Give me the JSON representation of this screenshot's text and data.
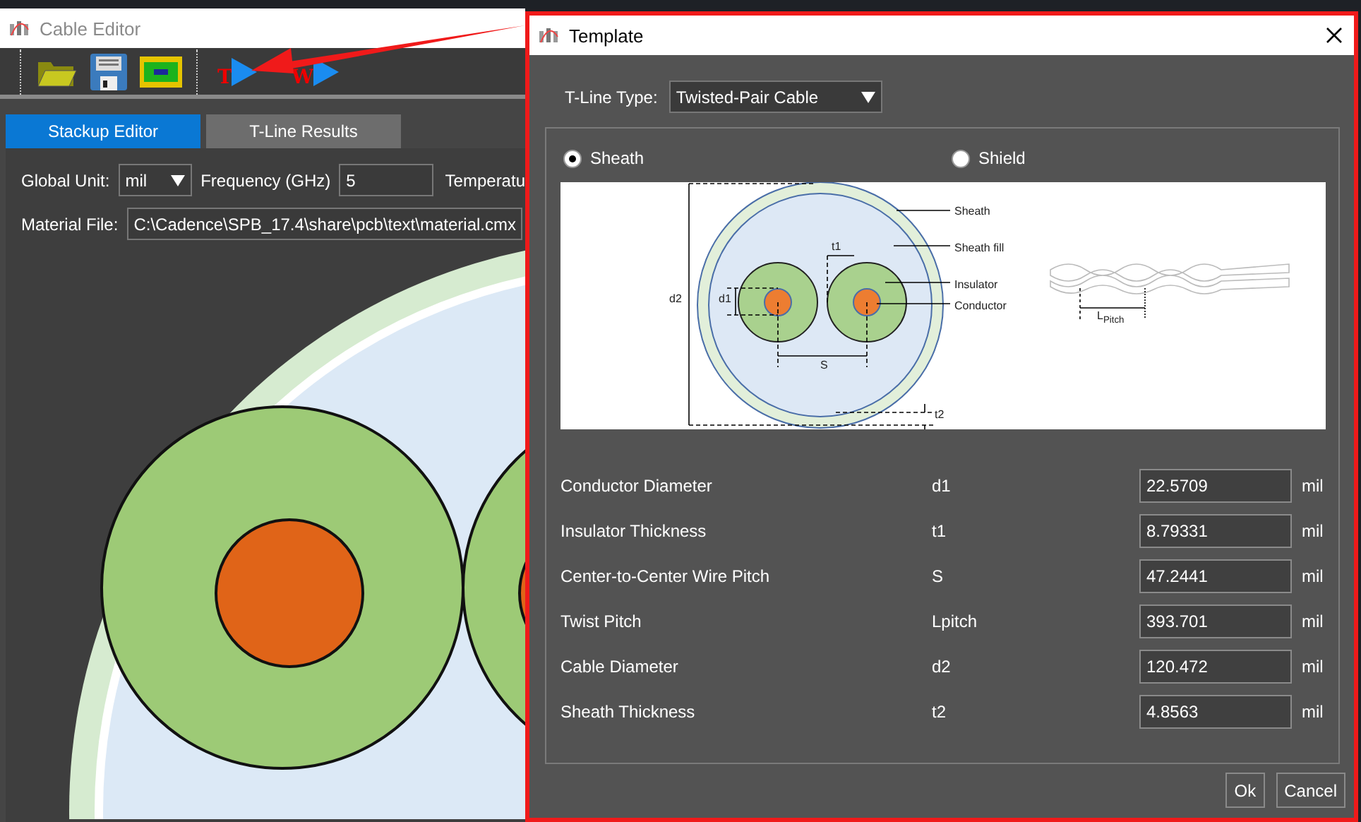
{
  "main_window": {
    "title": "Cable Editor",
    "toolbar": [
      {
        "kind": "open"
      },
      {
        "kind": "save"
      },
      {
        "kind": "layer"
      },
      {
        "kind": "tline",
        "letter": "T"
      },
      {
        "kind": "wline",
        "letter": "W"
      }
    ],
    "tabs": [
      {
        "label": "Stackup Editor",
        "selected": true
      },
      {
        "label": "T-Line Results",
        "selected": false
      }
    ],
    "global_unit": {
      "label": "Global Unit:",
      "value": "mil"
    },
    "frequency": {
      "label": "Frequency (GHz)",
      "value": "5"
    },
    "temperature": {
      "label": "Temperatu"
    },
    "material_file": {
      "label": "Material File:",
      "value": "C:\\Cadence\\SPB_17.4\\share\\pcb\\text\\material.cmx"
    }
  },
  "dialog": {
    "title": "Template",
    "tline_type": {
      "label": "T-Line Type:",
      "value": "Twisted-Pair Cable"
    },
    "options": [
      {
        "label": "Sheath",
        "selected": true
      },
      {
        "label": "Shield",
        "selected": false
      }
    ],
    "diagram_labels": [
      "Sheath",
      "Sheath fill",
      "Insulator",
      "Conductor",
      "d2",
      "d1",
      "t1",
      "S",
      "t2",
      "L$_{Pitch}$"
    ],
    "parameters": [
      {
        "name": "Conductor Diameter",
        "symbol": "d1",
        "value": "22.5709",
        "unit": "mil"
      },
      {
        "name": "Insulator Thickness",
        "symbol": "t1",
        "value": "8.79331",
        "unit": "mil"
      },
      {
        "name": "Center-to-Center Wire Pitch",
        "symbol": "S",
        "value": "47.2441",
        "unit": "mil"
      },
      {
        "name": "Twist Pitch",
        "symbol": "Lpitch",
        "value": "393.701",
        "unit": "mil"
      },
      {
        "name": "Cable Diameter",
        "symbol": "d2",
        "value": "120.472",
        "unit": "mil"
      },
      {
        "name": "Sheath Thickness",
        "symbol": "t2",
        "value": "4.8563",
        "unit": "mil"
      }
    ],
    "buttons": [
      "Ok",
      "Cancel"
    ]
  }
}
